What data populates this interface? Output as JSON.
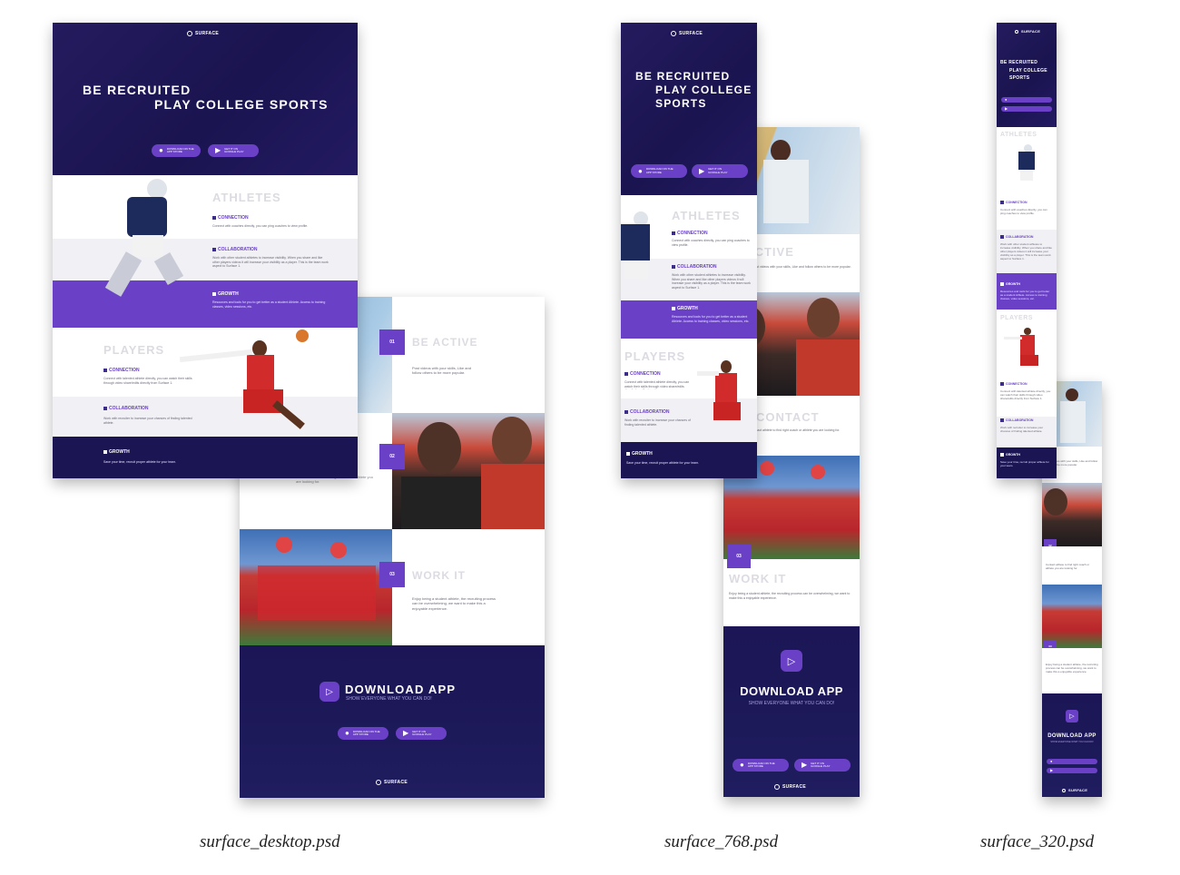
{
  "brand": {
    "logo_text": "SURFACE"
  },
  "hero": {
    "line1": "Be Recruited",
    "line2": "Play College Sports",
    "line2a": "Play College",
    "line2b": "Sports"
  },
  "store_buttons": {
    "appstore_top": "Download on the",
    "appstore_bottom": "App Store",
    "play_top": "Get it on",
    "play_bottom": "Google Play"
  },
  "athletes": {
    "title": "Athletes",
    "connection_label": "Connection",
    "connection_text": "Connect with coaches directly, you can ping coaches to view profile.",
    "collaboration_label": "Collaboration",
    "collaboration_text": "Work with other student athletes to increase visibility. When you share and like other players videos it will increase your visibility as a player. This is the team work aspect to Surface 1.",
    "growth_label": "Growth",
    "growth_text": "Resources and tools for you to get better as a student Athlete. Access to training classes, video sessions, etc."
  },
  "players": {
    "title": "Players",
    "connection_label": "Connection",
    "connection_text": "Connect with talented athlete directly, you can watch their skills through video share/edits directly from Surface 1.",
    "collaboration_label": "Collaboration",
    "collaboration_text": "Work with recruiter to increase your chances of finding talented athlete.",
    "growth_label": "Growth",
    "growth_text": "Save your time, recruit proper athlete for your team."
  },
  "features": [
    {
      "num": "01",
      "title": "Be Active",
      "text": "Post videos with your skills, Like and follow others to be more popular."
    },
    {
      "num": "02",
      "title": "Contact",
      "text": "Contact athlete to find right coach or athlete you are looking for."
    },
    {
      "num": "03",
      "title": "Work It",
      "text": "Enjoy being a student athlete, the recruiting process can be overwhelming, we want to make this a enjoyable experience."
    }
  ],
  "download": {
    "title": "Download App",
    "subtitle": "Show everyone what you can do!"
  },
  "captions": {
    "desktop": "surface_desktop.psd",
    "tablet": "surface_768.psd",
    "mobile": "surface_320.psd"
  },
  "colors": {
    "navy": "#1b1553",
    "purple": "#6a41c6",
    "light": "#f1f0f5"
  },
  "icons": {
    "apple": "apple-icon",
    "play": "play-store-icon",
    "logo": "surface-logo-icon",
    "download": "download-app-icon"
  }
}
